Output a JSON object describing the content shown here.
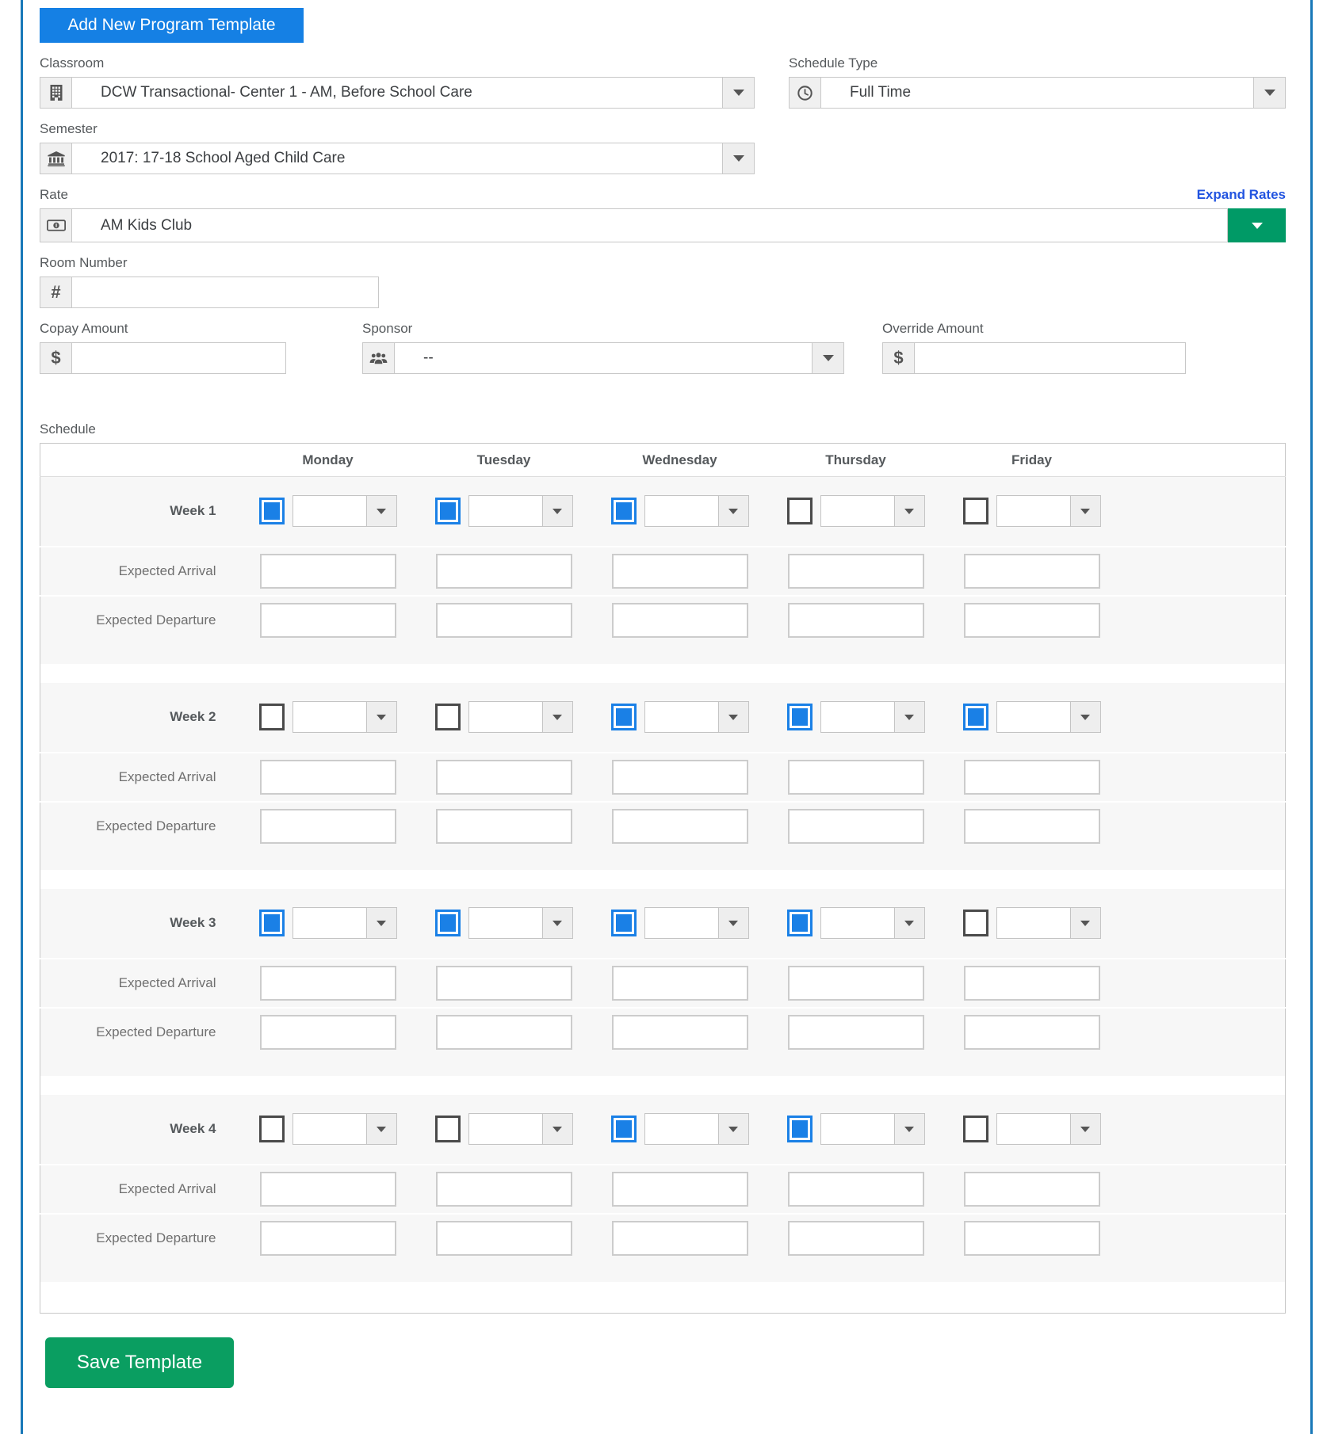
{
  "colors": {
    "primary_blue": "#1580e4",
    "link_blue": "#2254e0",
    "save_green": "#0a9e61",
    "rate_caret_green": "#009a66",
    "panel_border_blue": "#1878b8",
    "checkbox_checked_blue": "#1a80e6"
  },
  "toolbar": {
    "add_button_label": "Add New Program Template"
  },
  "form": {
    "classroom": {
      "label": "Classroom",
      "value": "DCW Transactional- Center 1 - AM, Before School Care"
    },
    "schedule_type": {
      "label": "Schedule Type",
      "value": "Full Time"
    },
    "semester": {
      "label": "Semester",
      "value": "2017: 17-18 School Aged Child Care"
    },
    "rate": {
      "label": "Rate",
      "value": "AM Kids Club",
      "expand_link_label": "Expand Rates"
    },
    "room_number": {
      "label": "Room Number",
      "value": "",
      "symbol": "#"
    },
    "copay_amount": {
      "label": "Copay Amount",
      "value": "",
      "symbol": "$"
    },
    "sponsor": {
      "label": "Sponsor",
      "value": "--"
    },
    "override_amount": {
      "label": "Override Amount",
      "value": "",
      "symbol": "$"
    }
  },
  "schedule": {
    "section_label": "Schedule",
    "day_headers": [
      "Monday",
      "Tuesday",
      "Wednesday",
      "Thursday",
      "Friday"
    ],
    "arrival_label": "Expected Arrival",
    "departure_label": "Expected Departure",
    "weeks": [
      {
        "label": "Week 1",
        "days_checked": [
          true,
          true,
          true,
          false,
          false
        ]
      },
      {
        "label": "Week 2",
        "days_checked": [
          false,
          false,
          true,
          true,
          true
        ]
      },
      {
        "label": "Week 3",
        "days_checked": [
          true,
          true,
          true,
          true,
          false
        ]
      },
      {
        "label": "Week 4",
        "days_checked": [
          false,
          false,
          true,
          true,
          false
        ]
      }
    ]
  },
  "footer": {
    "save_button_label": "Save Template"
  }
}
